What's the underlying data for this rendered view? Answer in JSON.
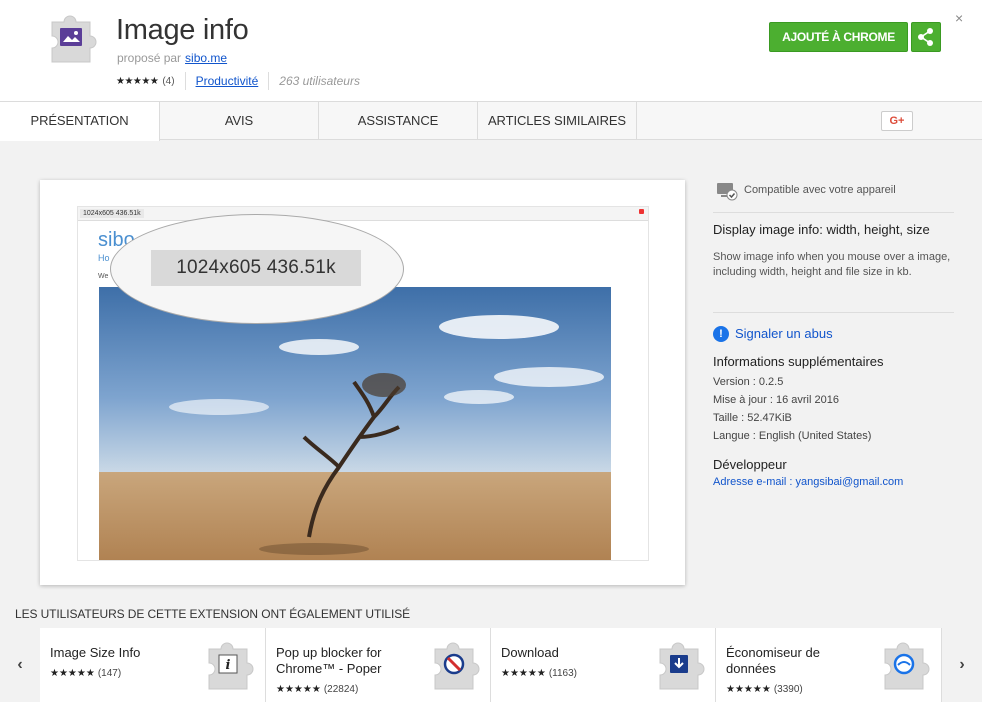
{
  "header": {
    "title": "Image info",
    "proposed_prefix": "proposé par",
    "author": "sibo.me",
    "stars": "★★★★★",
    "rating_count": "(4)",
    "category": "Productivité",
    "users": "263 utilisateurs",
    "add_button": "AJOUTÉ À CHROME",
    "close": "×"
  },
  "tabs": [
    {
      "label": "PRÉSENTATION"
    },
    {
      "label": "AVIS"
    },
    {
      "label": "ASSISTANCE"
    },
    {
      "label": "ARTICLES SIMILAIRES"
    }
  ],
  "gplus": "G+",
  "screenshot": {
    "tag": "1024x605  436.51k",
    "brand": "sibo",
    "nav": "Ho",
    "welcome": "We",
    "bubble_text": "1024x605  436.51k"
  },
  "details": {
    "compatible": "Compatible avec votre appareil",
    "desc_title": "Display image info: width, height, size",
    "desc_body": "Show image info when you mouse over a image, including width, height and file size in kb.",
    "report": "Signaler un abus",
    "info_title": "Informations supplémentaires",
    "version": "Version : 0.2.5",
    "updated": "Mise à jour : 16 avril 2016",
    "size": "Taille : 52.47KiB",
    "language": "Langue : English (United States)",
    "dev_title": "Développeur",
    "dev_email": "Adresse e-mail : yangsibai@gmail.com"
  },
  "related": {
    "title": "LES UTILISATEURS DE CETTE EXTENSION ONT ÉGALEMENT UTILISÉ",
    "prev": "‹",
    "next": "›",
    "items": [
      {
        "name": "Image Size Info",
        "stars": "★★★★★",
        "count": "(147)",
        "icon": "info-icon"
      },
      {
        "name": "Pop up blocker for Chrome™ - Poper",
        "stars": "★★★★★",
        "count": "(22824)",
        "icon": "block-icon"
      },
      {
        "name": "Download",
        "stars": "★★★★★",
        "count": "(1163)",
        "icon": "download-icon"
      },
      {
        "name": "Économiseur de données",
        "stars": "★★★★★",
        "count": "(3390)",
        "icon": "data-saver-icon"
      }
    ]
  },
  "colors": {
    "accent_green": "#4caf30",
    "link_blue": "#1155cc",
    "gplus_red": "#dd4b39"
  }
}
